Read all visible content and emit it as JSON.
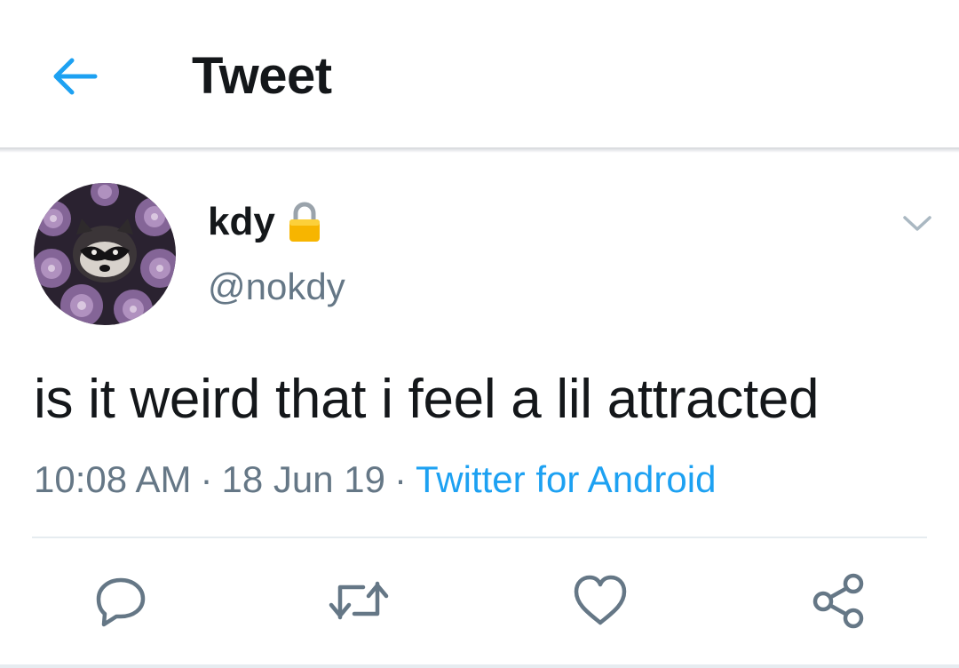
{
  "header": {
    "back_icon": "arrow-left-icon",
    "title": "Tweet"
  },
  "tweet": {
    "author": {
      "display_name": "kdy",
      "protected_icon": "lock-icon",
      "handle": "@nokdy",
      "avatar_icon": "raccoon-avatar"
    },
    "menu_icon": "chevron-down-icon",
    "text": "is it weird that i feel a lil attracted",
    "time": "10:08 AM",
    "separator": "·",
    "date": "18 Jun 19",
    "source": "Twitter for Android"
  },
  "actions": [
    {
      "name": "reply",
      "icon": "reply-icon"
    },
    {
      "name": "retweet",
      "icon": "retweet-icon"
    },
    {
      "name": "like",
      "icon": "heart-icon"
    },
    {
      "name": "share",
      "icon": "share-icon"
    }
  ],
  "colors": {
    "accent": "#1da1f2",
    "text": "#14171a",
    "secondary": "#657786",
    "icon": "#657786",
    "divider": "#e6ecf0"
  }
}
